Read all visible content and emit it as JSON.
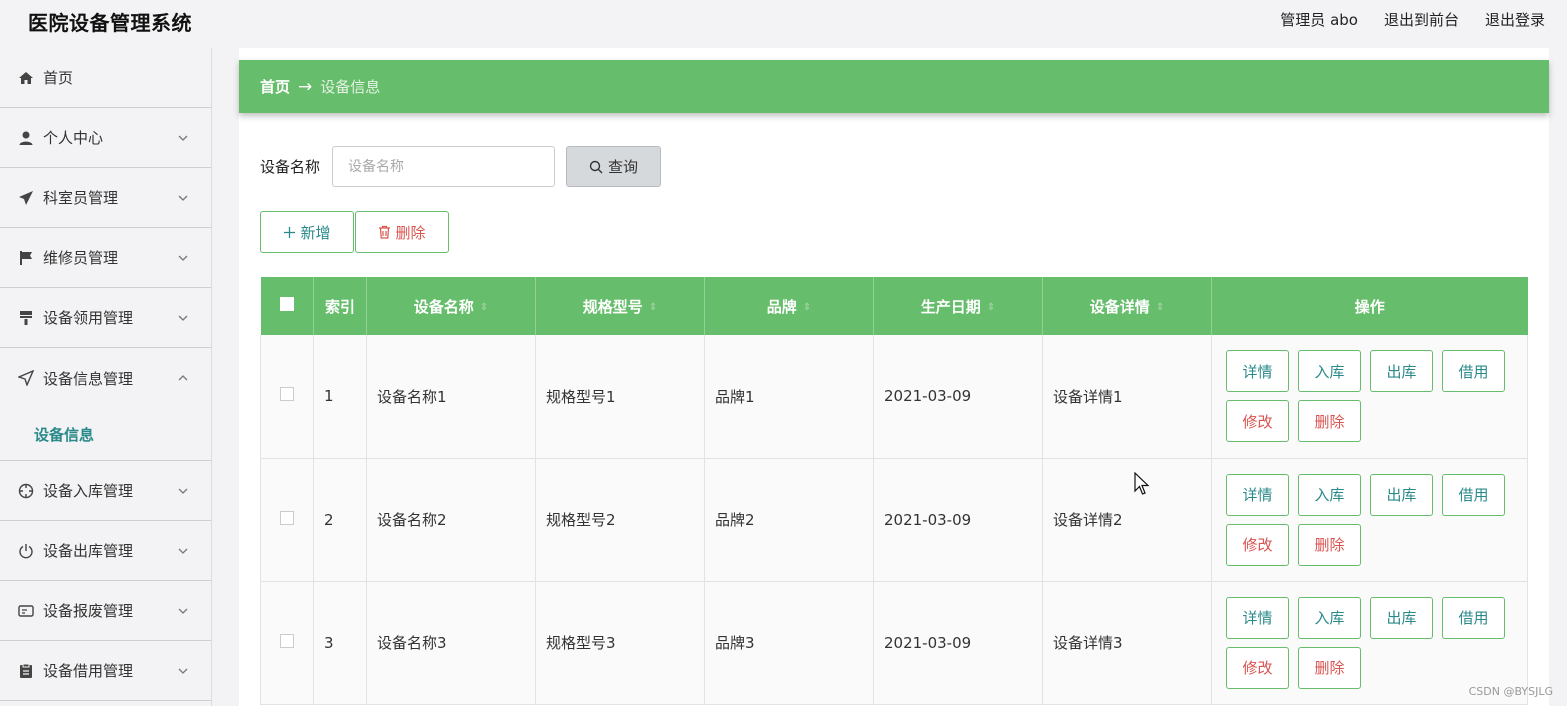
{
  "app": {
    "title": "医院设备管理系统"
  },
  "topnav": {
    "admin": "管理员 abo",
    "front": "退出到前台",
    "logout": "退出登录"
  },
  "sidebar": {
    "items": [
      {
        "label": "首页",
        "icon": "home-icon"
      },
      {
        "label": "个人中心",
        "icon": "user-icon"
      },
      {
        "label": "科室员管理",
        "icon": "send-icon"
      },
      {
        "label": "维修员管理",
        "icon": "flag-icon"
      },
      {
        "label": "设备领用管理",
        "icon": "brush-icon"
      },
      {
        "label": "设备信息管理",
        "icon": "navigation-icon"
      },
      {
        "label": "设备入库管理",
        "icon": "crosshair-icon"
      },
      {
        "label": "设备出库管理",
        "icon": "power-icon"
      },
      {
        "label": "设备报废管理",
        "icon": "card-icon"
      },
      {
        "label": "设备借用管理",
        "icon": "clipboard-icon"
      }
    ],
    "sub_item": "设备信息"
  },
  "breadcrumb": {
    "home": "首页",
    "arrow": "→",
    "current": "设备信息"
  },
  "search": {
    "label": "设备名称",
    "placeholder": "设备名称",
    "button": "查询"
  },
  "actions": {
    "add": "新增",
    "delete": "删除"
  },
  "table": {
    "headers": [
      "索引",
      "设备名称",
      "规格型号",
      "品牌",
      "生产日期",
      "设备详情",
      "操作"
    ],
    "rows": [
      {
        "index": "1",
        "name": "设备名称1",
        "model": "规格型号1",
        "brand": "品牌1",
        "date": "2021-03-09",
        "detail": "设备详情1"
      },
      {
        "index": "2",
        "name": "设备名称2",
        "model": "规格型号2",
        "brand": "品牌2",
        "date": "2021-03-09",
        "detail": "设备详情2"
      },
      {
        "index": "3",
        "name": "设备名称3",
        "model": "规格型号3",
        "brand": "品牌3",
        "date": "2021-03-09",
        "detail": "设备详情3"
      }
    ],
    "ops": {
      "detail": "详情",
      "in": "入库",
      "out": "出库",
      "borrow": "借用",
      "edit": "修改",
      "delete": "删除"
    }
  },
  "watermark": "CSDN @BYSJLG",
  "colors": {
    "accent": "#66bd6b",
    "teal": "#2a8a8a",
    "danger": "#d9534f"
  }
}
